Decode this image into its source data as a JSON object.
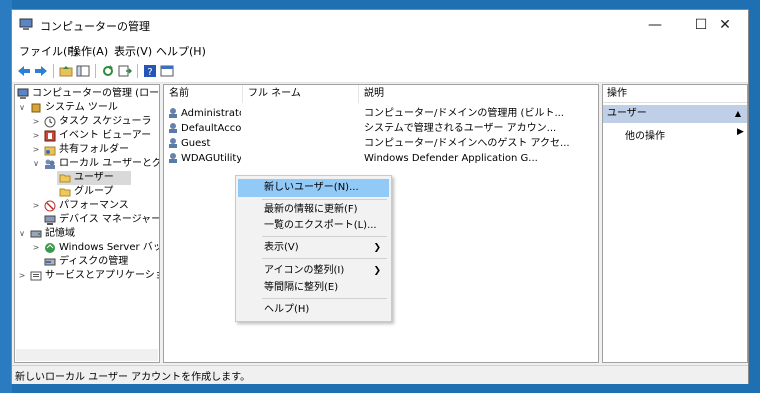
{
  "window": {
    "title": "コンピューターの管理"
  },
  "menu": [
    "ファイル(F)",
    "操作(A)",
    "表示(V)",
    "ヘルプ(H)"
  ],
  "tree": {
    "root": "コンピューターの管理 (ローカル)",
    "system_tools": "システム ツール",
    "task_scheduler": "タスク スケジューラ",
    "event_viewer": "イベント ビューアー",
    "shared_folders": "共有フォルダー",
    "local_users_groups": "ローカル ユーザーとグループ",
    "users": "ユーザー",
    "groups": "グループ",
    "performance": "パフォーマンス",
    "device_manager": "デバイス マネージャー",
    "storage": "記憶域",
    "windows_server_backup": "Windows Server バックア",
    "disk_management": "ディスクの管理",
    "services_apps": "サービスとアプリケーション"
  },
  "list": {
    "columns": [
      "名前",
      "フル ネーム",
      "説明"
    ],
    "rows": [
      {
        "name": "Administrator",
        "fullname": "",
        "desc": "コンピューター/ドメインの管理用 (ビルト..."
      },
      {
        "name": "DefaultAcco...",
        "fullname": "",
        "desc": "システムで管理されるユーザー アカウン..."
      },
      {
        "name": "Guest",
        "fullname": "",
        "desc": "コンピューター/ドメインへのゲスト アクセ..."
      },
      {
        "name": "WDAGUtility...",
        "fullname": "",
        "desc": "Windows Defender Application G..."
      }
    ]
  },
  "actions": {
    "title": "操作",
    "section": "ユーザー",
    "item": "他の操作"
  },
  "context_menu": {
    "new_user": "新しいユーザー(N)...",
    "refresh": "最新の情報に更新(F)",
    "export": "一覧のエクスポート(L)...",
    "view": "表示(V)",
    "arrange_icons": "アイコンの整列(I)",
    "line_up": "等間隔に整列(E)",
    "help": "ヘルプ(H)"
  },
  "status": "新しいローカル ユーザー アカウントを作成します。",
  "colors": {
    "desktop": "#1f6fb3",
    "menu_highlight": "#91c9f7",
    "action_header": "#bfcfe8"
  }
}
